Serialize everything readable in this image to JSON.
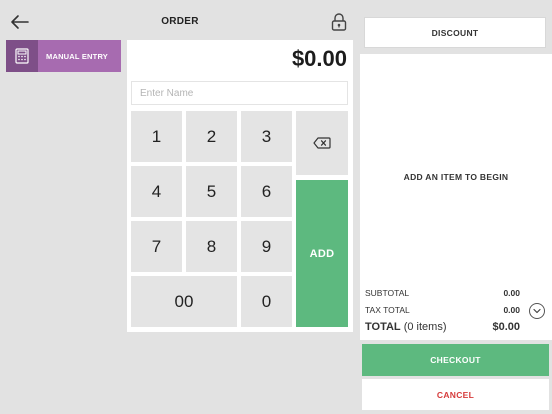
{
  "header": {
    "title": "ORDER",
    "back_icon": "arrow-left-icon",
    "lock_icon": "lock-icon"
  },
  "manual_entry": {
    "label": "MANUAL ENTRY",
    "icon": "calculator-icon"
  },
  "keypad": {
    "amount": "$0.00",
    "name_placeholder": "Enter Name",
    "name_value": "",
    "keys": [
      "1",
      "2",
      "3",
      "4",
      "5",
      "6",
      "7",
      "8",
      "9",
      "00",
      "0"
    ],
    "backspace_icon": "backspace-icon",
    "add_label": "ADD"
  },
  "order_panel": {
    "discount_label": "DISCOUNT",
    "empty_message": "ADD AN ITEM TO BEGIN",
    "subtotal_label": "SUBTOTAL",
    "subtotal_value": "0.00",
    "tax_label": "TAX TOTAL",
    "tax_value": "0.00",
    "total_label": "TOTAL",
    "total_items": "(0 items)",
    "total_value": "$0.00",
    "expand_icon": "chevron-down-icon",
    "checkout_label": "CHECKOUT",
    "cancel_label": "CANCEL"
  },
  "colors": {
    "background": "#e2e2e2",
    "accent_purple": "#a76bb0",
    "accent_green": "#5db97f",
    "cancel_red": "#d63b3b"
  }
}
